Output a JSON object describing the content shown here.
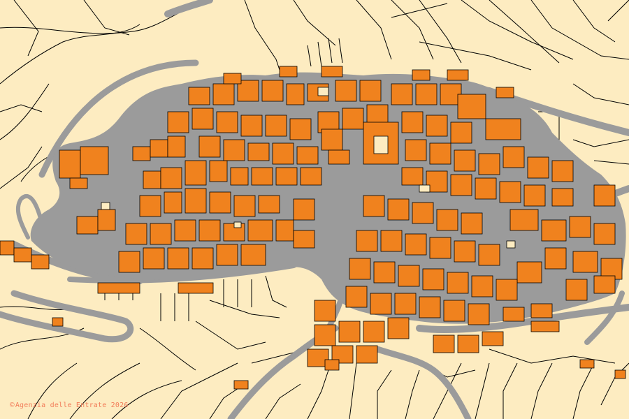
{
  "map": {
    "attribution_symbol": "©",
    "attribution_text": "Agenzia delle Entrate 2026",
    "colors": {
      "background": "#fdecc1",
      "parcel_line": "#000000",
      "road": "#9b9b9b",
      "building": "#f0821e",
      "attribution": "#f27d5a"
    }
  }
}
